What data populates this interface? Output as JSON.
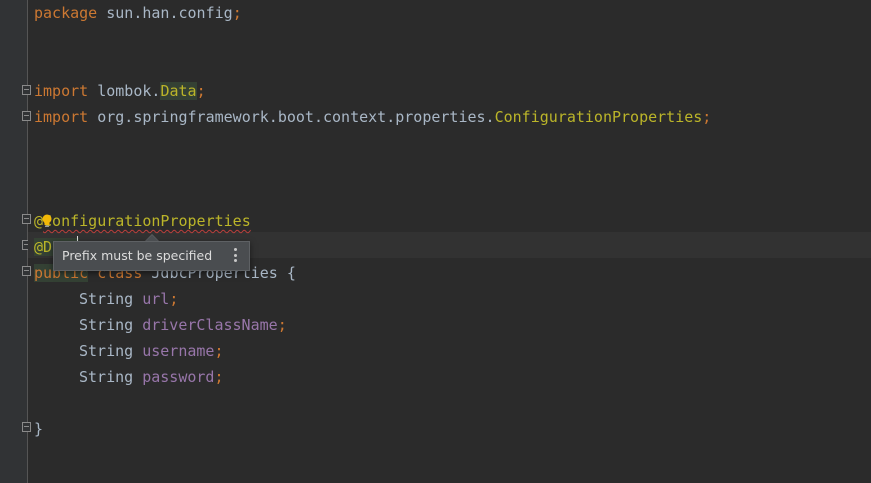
{
  "editor": {
    "lines": {
      "package_kw": "package",
      "package_name": " sun.han.config",
      "package_semi": ";",
      "import1_kw": "import",
      "import1_path": " lombok.",
      "import1_cls": "Data",
      "import1_semi": ";",
      "import2_kw": "import",
      "import2_path": " org.springframework.boot.context.properties.",
      "import2_cls": "ConfigurationProperties",
      "import2_semi": ";",
      "ann1_at": "@",
      "ann1_name": "ConfigurationProperties",
      "ann2": "@Data",
      "class_kw1": "public",
      "class_kw2": " class",
      "class_name": " JdbcProperties",
      "class_brace": " {",
      "field_type": "String",
      "field1": "url",
      "field2": "driverClassName",
      "field3": "username",
      "field4": "password",
      "semi": ";",
      "close_brace": "}"
    }
  },
  "tooltip": {
    "message": "Prefix must be specified"
  },
  "colors": {
    "background": "#2b2b2b",
    "keyword": "#cc7832",
    "annotation": "#bbb529",
    "field": "#9876aa",
    "text": "#a9b7c6"
  },
  "icons": {
    "intention": "lightbulb-icon",
    "more": "more-vertical-icon",
    "fold": "fold-marker-icon"
  }
}
